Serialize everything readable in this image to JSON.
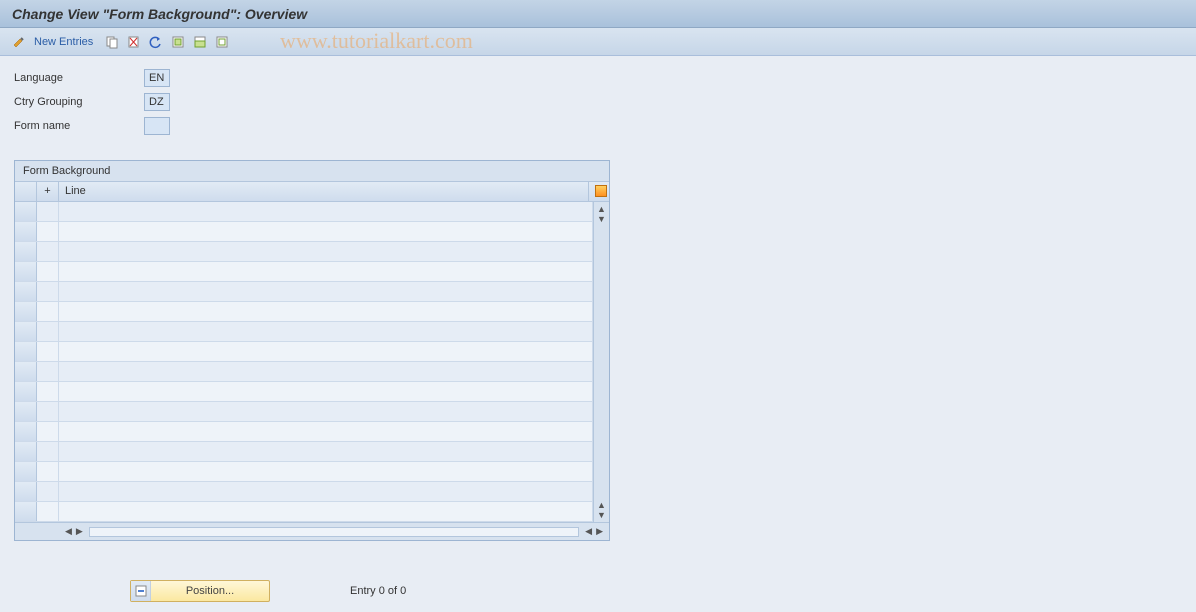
{
  "title": "Change View \"Form Background\": Overview",
  "watermark": "www.tutorialkart.com",
  "toolbar": {
    "new_entries_label": "New Entries"
  },
  "fields": {
    "language_label": "Language",
    "language_value": "EN",
    "ctry_grouping_label": "Ctry Grouping",
    "ctry_grouping_value": "DZ",
    "form_name_label": "Form name",
    "form_name_value": ""
  },
  "table": {
    "caption": "Form Background",
    "header": {
      "plus": "+",
      "line": "Line"
    }
  },
  "footer": {
    "position_label": "Position...",
    "entry_text": "Entry 0 of 0"
  }
}
